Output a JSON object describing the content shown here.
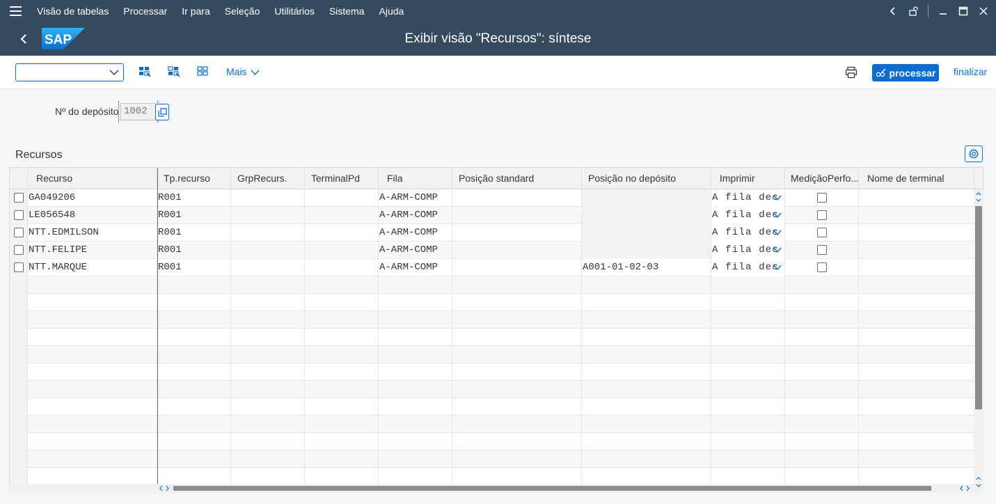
{
  "menubar": {
    "items": [
      "Visão de tabelas",
      "Processar",
      "Ir para",
      "Seleção",
      "Utilitários",
      "Sistema",
      "Ajuda"
    ]
  },
  "titlebar": {
    "title": "Exibir visão \"Recursos\": síntese",
    "logo_text": "SAP"
  },
  "toolbar": {
    "variant_value": "",
    "more_label": "Mais",
    "process_label": "processar",
    "finish_label": "finalizar"
  },
  "selection": {
    "warehouse_label": "Nº do depósito",
    "warehouse_value": "1002"
  },
  "table": {
    "title": "Recursos",
    "columns": [
      "Recurso",
      "Tp.recurso",
      "GrpRecurs.",
      "TerminalPd",
      "Fila",
      "Posição standard",
      "Posição no depósito",
      "Imprimir",
      "MediçãoPerfo...",
      "Nome de terminal"
    ],
    "rows": [
      {
        "recurso": "GA049206",
        "tp": "R001",
        "grp": "",
        "terminal": "",
        "fila": "A-ARM-COMP",
        "pos_std": "",
        "pos_dep": "",
        "imprimir": "A fila dec",
        "medicao": false,
        "nome_term": ""
      },
      {
        "recurso": "LE056548",
        "tp": "R001",
        "grp": "",
        "terminal": "",
        "fila": "A-ARM-COMP",
        "pos_std": "",
        "pos_dep": "",
        "imprimir": "A fila dec",
        "medicao": false,
        "nome_term": ""
      },
      {
        "recurso": "NTT.EDMILSON",
        "tp": "R001",
        "grp": "",
        "terminal": "",
        "fila": "A-ARM-COMP",
        "pos_std": "",
        "pos_dep": "",
        "imprimir": "A fila dec",
        "medicao": false,
        "nome_term": ""
      },
      {
        "recurso": "NTT.FELIPE",
        "tp": "R001",
        "grp": "",
        "terminal": "",
        "fila": "A-ARM-COMP",
        "pos_std": "",
        "pos_dep": "",
        "imprimir": "A fila dec",
        "medicao": false,
        "nome_term": ""
      },
      {
        "recurso": "NTT.MARQUE",
        "tp": "R001",
        "grp": "",
        "terminal": "",
        "fila": "A-ARM-COMP",
        "pos_std": "",
        "pos_dep": "A001-01-02-03",
        "imprimir": "A fila dec",
        "medicao": false,
        "nome_term": ""
      }
    ]
  },
  "colors": {
    "shell": "#354a5f",
    "accent": "#0a6ed1"
  }
}
